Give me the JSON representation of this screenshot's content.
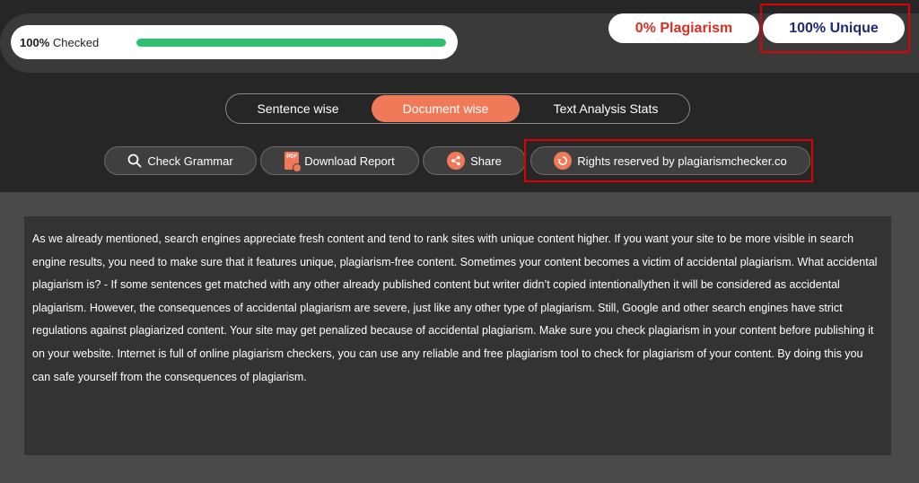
{
  "progress": {
    "percent": "100%",
    "label": "Checked",
    "fill": 1.0
  },
  "results": {
    "plagiarism": "0% Plagiarism",
    "unique": "100% Unique"
  },
  "tabs": [
    {
      "label": "Sentence wise"
    },
    {
      "label": "Document wise"
    },
    {
      "label": "Text Analysis Stats"
    }
  ],
  "actions": {
    "grammar": "Check Grammar",
    "report": "Download Report",
    "share": "Share",
    "rights": "Rights reserved by plagiarismchecker.co"
  },
  "icons": {
    "grammar": "search-icon",
    "report": "pdf-download-icon",
    "share": "share-icon",
    "rights": "refresh-icon"
  },
  "colors": {
    "accent": "#f0795a",
    "progress": "#2fbf71",
    "plagiarism": "#d93025",
    "unique": "#1e2a78",
    "highlight_box": "#e00000"
  },
  "content": {
    "text": "As we already mentioned, search engines appreciate fresh content and tend to rank sites with unique content higher. If you want your site to be more visible in search engine results, you need to make sure that it features unique, plagiarism-free content. Sometimes your content becomes a victim of accidental plagiarism. What accidental plagiarism is? - If some sentences get matched with any other already published content but writer didn’t copied intentionallythen it will be considered as accidental plagiarism. However, the consequences of accidental plagiarism are severe, just like any other type of plagiarism. Still, Google and other search engines have strict regulations against plagiarized content. Your site may get penalized because of accidental plagiarism. Make sure you check plagiarism in your content before publishing it on your website. Internet is full of online plagiarism checkers, you can use any reliable and free plagiarism tool to check for plagiarism of your content. By doing this you can safe yourself from the consequences of plagiarism."
  }
}
